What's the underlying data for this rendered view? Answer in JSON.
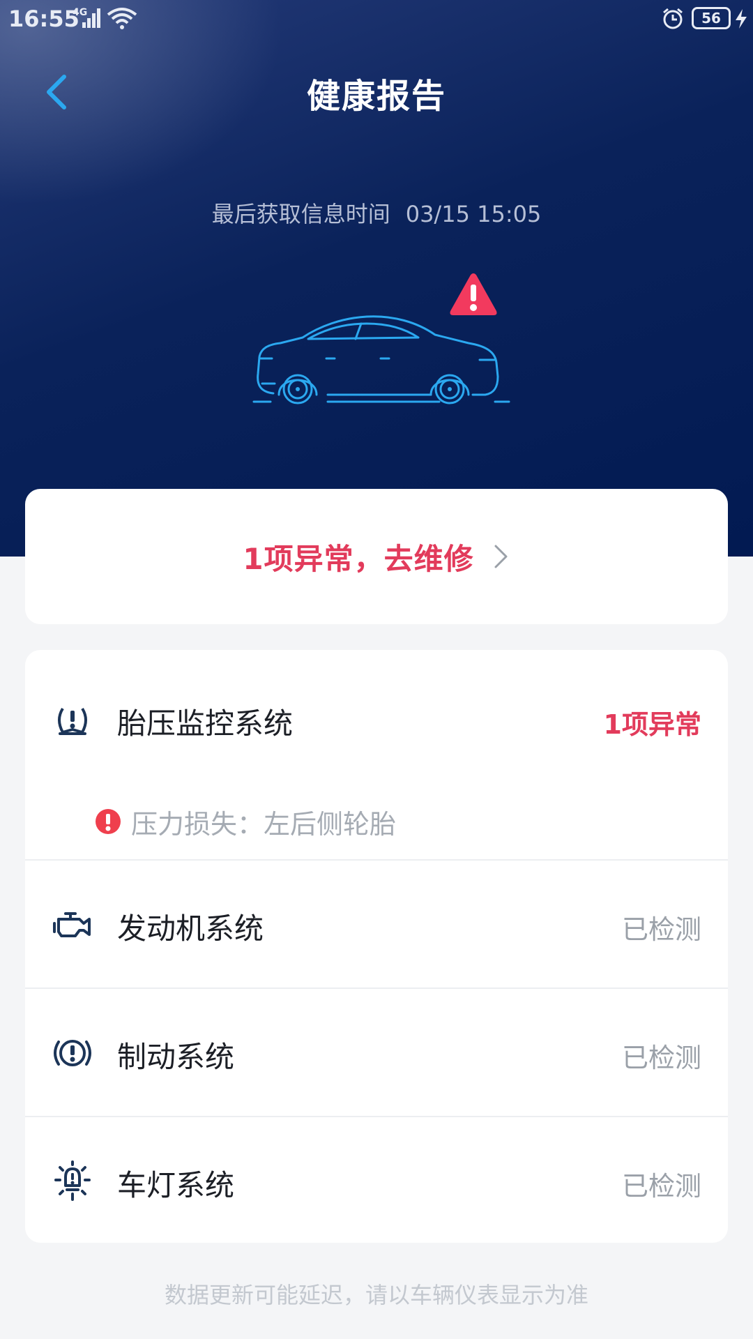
{
  "status_bar": {
    "time": "16:55",
    "network": "4G",
    "battery": "56"
  },
  "header": {
    "title": "健康报告",
    "info_label": "最后获取信息时间",
    "info_time": "03/15 15:05"
  },
  "colors": {
    "accent": "#2ba8f0",
    "alert": "#e23b5b",
    "hero_bg": "#0a225a"
  },
  "repair_banner": {
    "text": "1项异常，去维修"
  },
  "systems": [
    {
      "icon": "tire-pressure-icon",
      "name": "胎压监控系统",
      "status": "1项异常",
      "issue": "压力损失：左后侧轮胎"
    },
    {
      "icon": "engine-icon",
      "name": "发动机系统",
      "status": "已检测"
    },
    {
      "icon": "brake-icon",
      "name": "制动系统",
      "status": "已检测"
    },
    {
      "icon": "light-icon",
      "name": "车灯系统",
      "status": "已检测"
    }
  ],
  "footer": {
    "note": "数据更新可能延迟，请以车辆仪表显示为准"
  }
}
